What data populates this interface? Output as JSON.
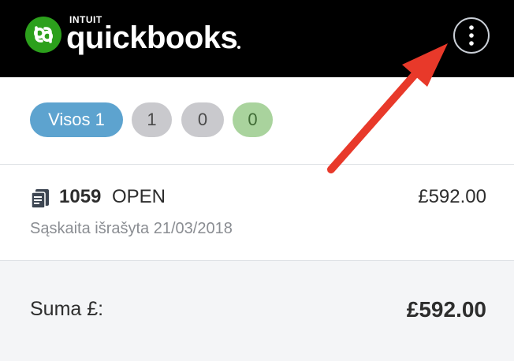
{
  "header": {
    "brand_top": "INTUIT",
    "brand_main": "quickbooks",
    "logo_icon": "quickbooks-logo-icon",
    "menu_icon": "more-vertical-icon",
    "background": "#000000",
    "logo_color": "#2ca01c"
  },
  "filters": [
    {
      "label": "Visos 1",
      "color": "#5da3cf"
    },
    {
      "label": "1",
      "color": "#c9c9cd"
    },
    {
      "label": "0",
      "color": "#c9c9cd"
    },
    {
      "label": "0",
      "color": "#a9d39d"
    }
  ],
  "invoice": {
    "icon": "invoice-document-icon",
    "number": "1059",
    "status": "OPEN",
    "amount": "£592.00",
    "subtitle": "Sąskaita išrašyta 21/03/2018"
  },
  "total": {
    "label": "Suma £:",
    "amount": "£592.00"
  },
  "annotation": {
    "arrow_color": "#e8392a"
  }
}
